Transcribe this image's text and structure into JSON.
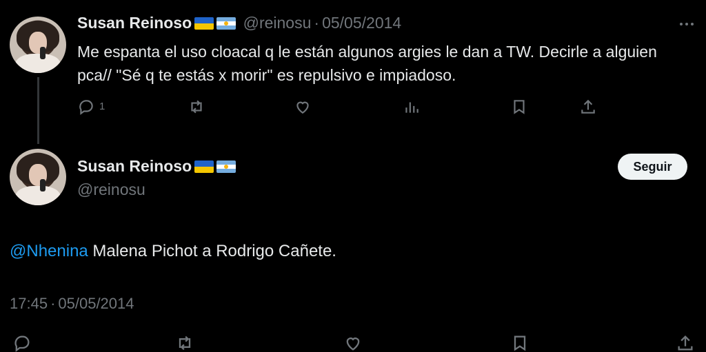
{
  "tweet1": {
    "author_name": "Susan Reinoso",
    "handle": "@reinosu",
    "separator": "·",
    "date": "05/05/2014",
    "text": "Me espanta el uso cloacal q le están algunos argies le dan a TW. Decirle a alguien pca// \"Sé q te estás x morir\" es repulsivo e impiadoso.",
    "reply_count": "1",
    "more_icon": "more-dots-icon"
  },
  "tweet2": {
    "author_name": "Susan Reinoso",
    "handle": "@reinosu",
    "follow_label": "Seguir",
    "mention": "@Nhenina",
    "text": " Malena Pichot a Rodrigo Cañete.",
    "time": "17:45",
    "separator": "·",
    "date": "05/05/2014"
  },
  "colors": {
    "background": "#000000",
    "text": "#e7e9ea",
    "muted": "#71767b",
    "link": "#1d9bf0",
    "button_bg": "#eff3f4"
  }
}
